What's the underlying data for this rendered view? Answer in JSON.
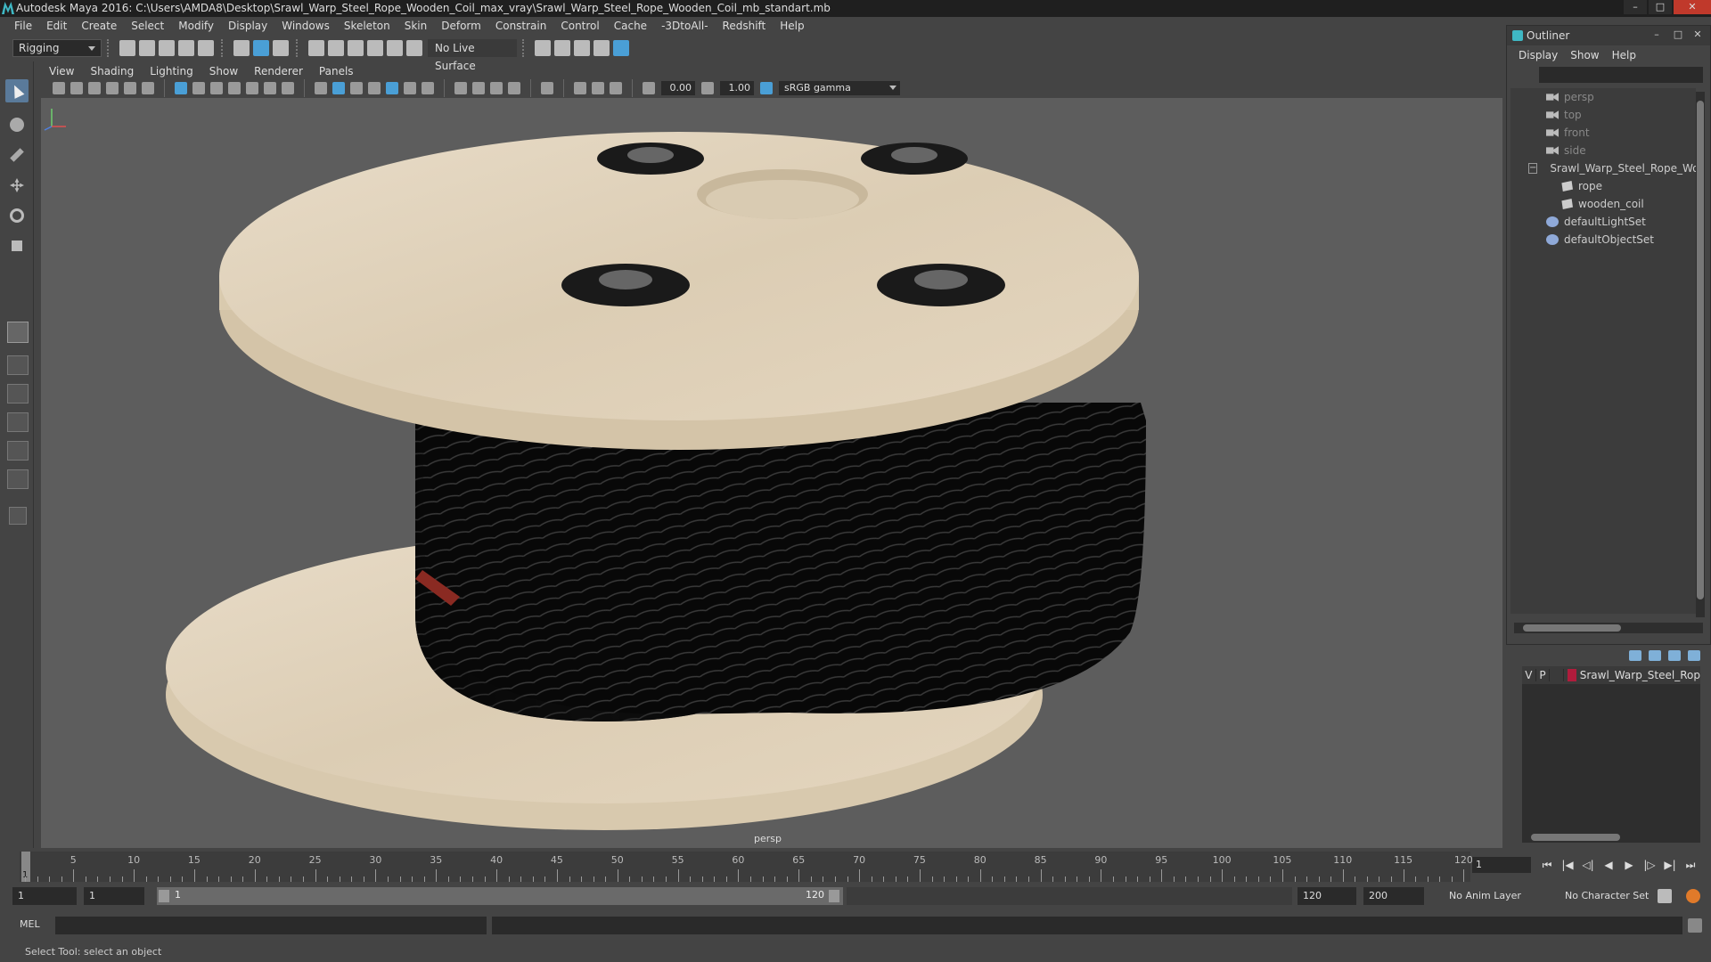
{
  "window": {
    "title": "Autodesk Maya 2016: C:\\Users\\AMDA8\\Desktop\\Srawl_Warp_Steel_Rope_Wooden_Coil_max_vray\\Srawl_Warp_Steel_Rope_Wooden_Coil_mb_standart.mb",
    "minimize": "–",
    "maximize": "□",
    "close": "✕"
  },
  "menubar": [
    "File",
    "Edit",
    "Create",
    "Select",
    "Modify",
    "Display",
    "Windows",
    "Skeleton",
    "Skin",
    "Deform",
    "Constrain",
    "Control",
    "Cache",
    "-3DtoAll-",
    "Redshift",
    "Help"
  ],
  "statusline": {
    "mode": "Rigging",
    "live_surface": "No Live Surface"
  },
  "viewport": {
    "menu": [
      "View",
      "Shading",
      "Lighting",
      "Show",
      "Renderer",
      "Panels"
    ],
    "field_a": "0.00",
    "field_b": "1.00",
    "color_space": "sRGB gamma",
    "camera": "persp"
  },
  "outliner": {
    "title": "Outliner",
    "menu": [
      "Display",
      "Show",
      "Help"
    ],
    "items": [
      {
        "label": "persp",
        "icon": "camera-icon",
        "dim": true
      },
      {
        "label": "top",
        "icon": "camera-icon",
        "dim": true
      },
      {
        "label": "front",
        "icon": "camera-icon",
        "dim": true
      },
      {
        "label": "side",
        "icon": "camera-icon",
        "dim": true
      },
      {
        "label": "Srawl_Warp_Steel_Rope_Wo",
        "icon": "group-icon",
        "dim": false
      },
      {
        "label": "rope",
        "icon": "mesh-icon",
        "dim": false
      },
      {
        "label": "wooden_coil",
        "icon": "mesh-icon",
        "dim": false
      },
      {
        "label": "defaultLightSet",
        "icon": "set-icon",
        "dim": false
      },
      {
        "label": "defaultObjectSet",
        "icon": "set-icon",
        "dim": false
      }
    ]
  },
  "layers": {
    "v": "V",
    "p": "P",
    "name": "Srawl_Warp_Steel_Rop",
    "color": "#b01c3c"
  },
  "timeslider": {
    "ticks": [
      "5",
      "10",
      "15",
      "20",
      "25",
      "30",
      "35",
      "40",
      "45",
      "50",
      "55",
      "60",
      "65",
      "70",
      "75",
      "80",
      "85",
      "90",
      "95",
      "100",
      "105",
      "110",
      "115",
      "120"
    ],
    "current_frame": "1",
    "frame_field": "1"
  },
  "rangeslider": {
    "start": "1",
    "anim_start": "1",
    "range_start_label": "1",
    "range_end_label": "120",
    "end": "120",
    "anim_end": "200",
    "anim_layer": "No Anim Layer",
    "character_set": "No Character Set"
  },
  "cmdline": {
    "label": "MEL"
  },
  "helpline": {
    "text": "Select Tool: select an object"
  }
}
